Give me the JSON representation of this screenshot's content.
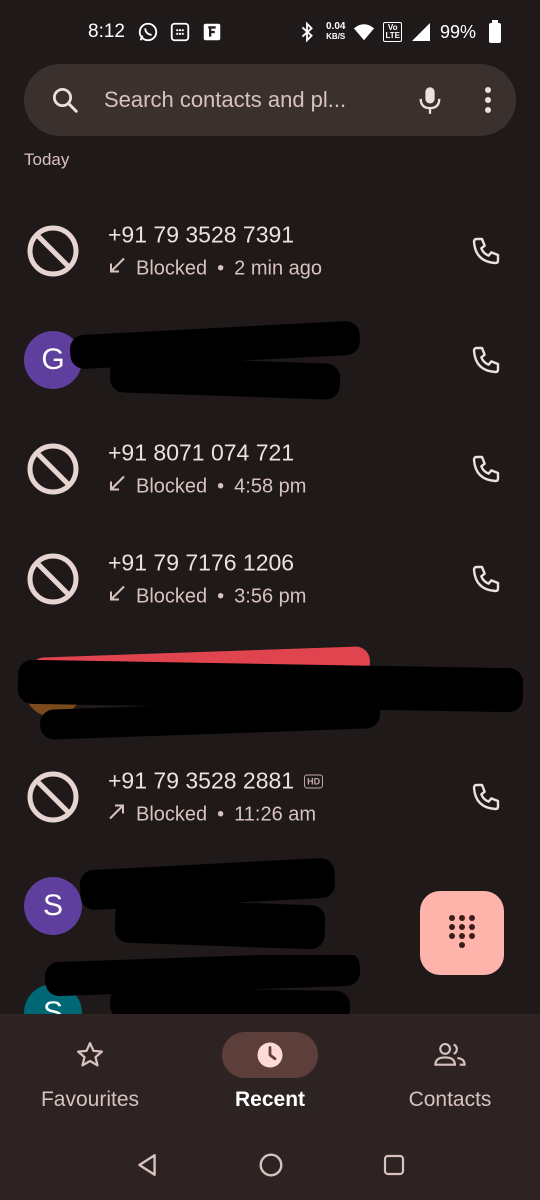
{
  "status_bar": {
    "time": "8:12",
    "net_speed_value": "0.04",
    "net_speed_unit": "KB/S",
    "volte_line1": "Vo",
    "volte_line2": "LTE",
    "battery": "99%"
  },
  "search": {
    "placeholder": "Search contacts and pl..."
  },
  "section_label": "Today",
  "calls": [
    {
      "number": "+91 79 3528 7391",
      "status": "Blocked",
      "time": "2 min ago",
      "direction": "incoming"
    },
    {
      "avatar_letter": "G",
      "avatar_color": "#5e3f9e",
      "direction": "outgoing"
    },
    {
      "number": "+91 8071 074 721",
      "status": "Blocked",
      "time": "4:58 pm",
      "direction": "incoming"
    },
    {
      "number": "+91 79 7176 1206",
      "status": "Blocked",
      "time": "3:56 pm",
      "direction": "incoming"
    },
    {
      "avatar_color": "#7a4a1c",
      "direction": "outgoing"
    },
    {
      "number": "+91 79 3528 2881",
      "hd_badge": "HD",
      "status": "Blocked",
      "time": "11:26 am",
      "direction": "outgoing"
    },
    {
      "avatar_letter": "S",
      "avatar_color": "#5e3f9e",
      "direction": "outgoing"
    },
    {
      "avatar_letter": "S",
      "avatar_color": "#006874",
      "direction": "outgoing"
    }
  ],
  "separator": "•",
  "bottom_nav": {
    "favourites": "Favourites",
    "recent": "Recent",
    "contacts": "Contacts"
  },
  "colors": {
    "background": "#1f1a19",
    "fab": "#ffb4ab",
    "active_pill": "#5c3f3b"
  }
}
